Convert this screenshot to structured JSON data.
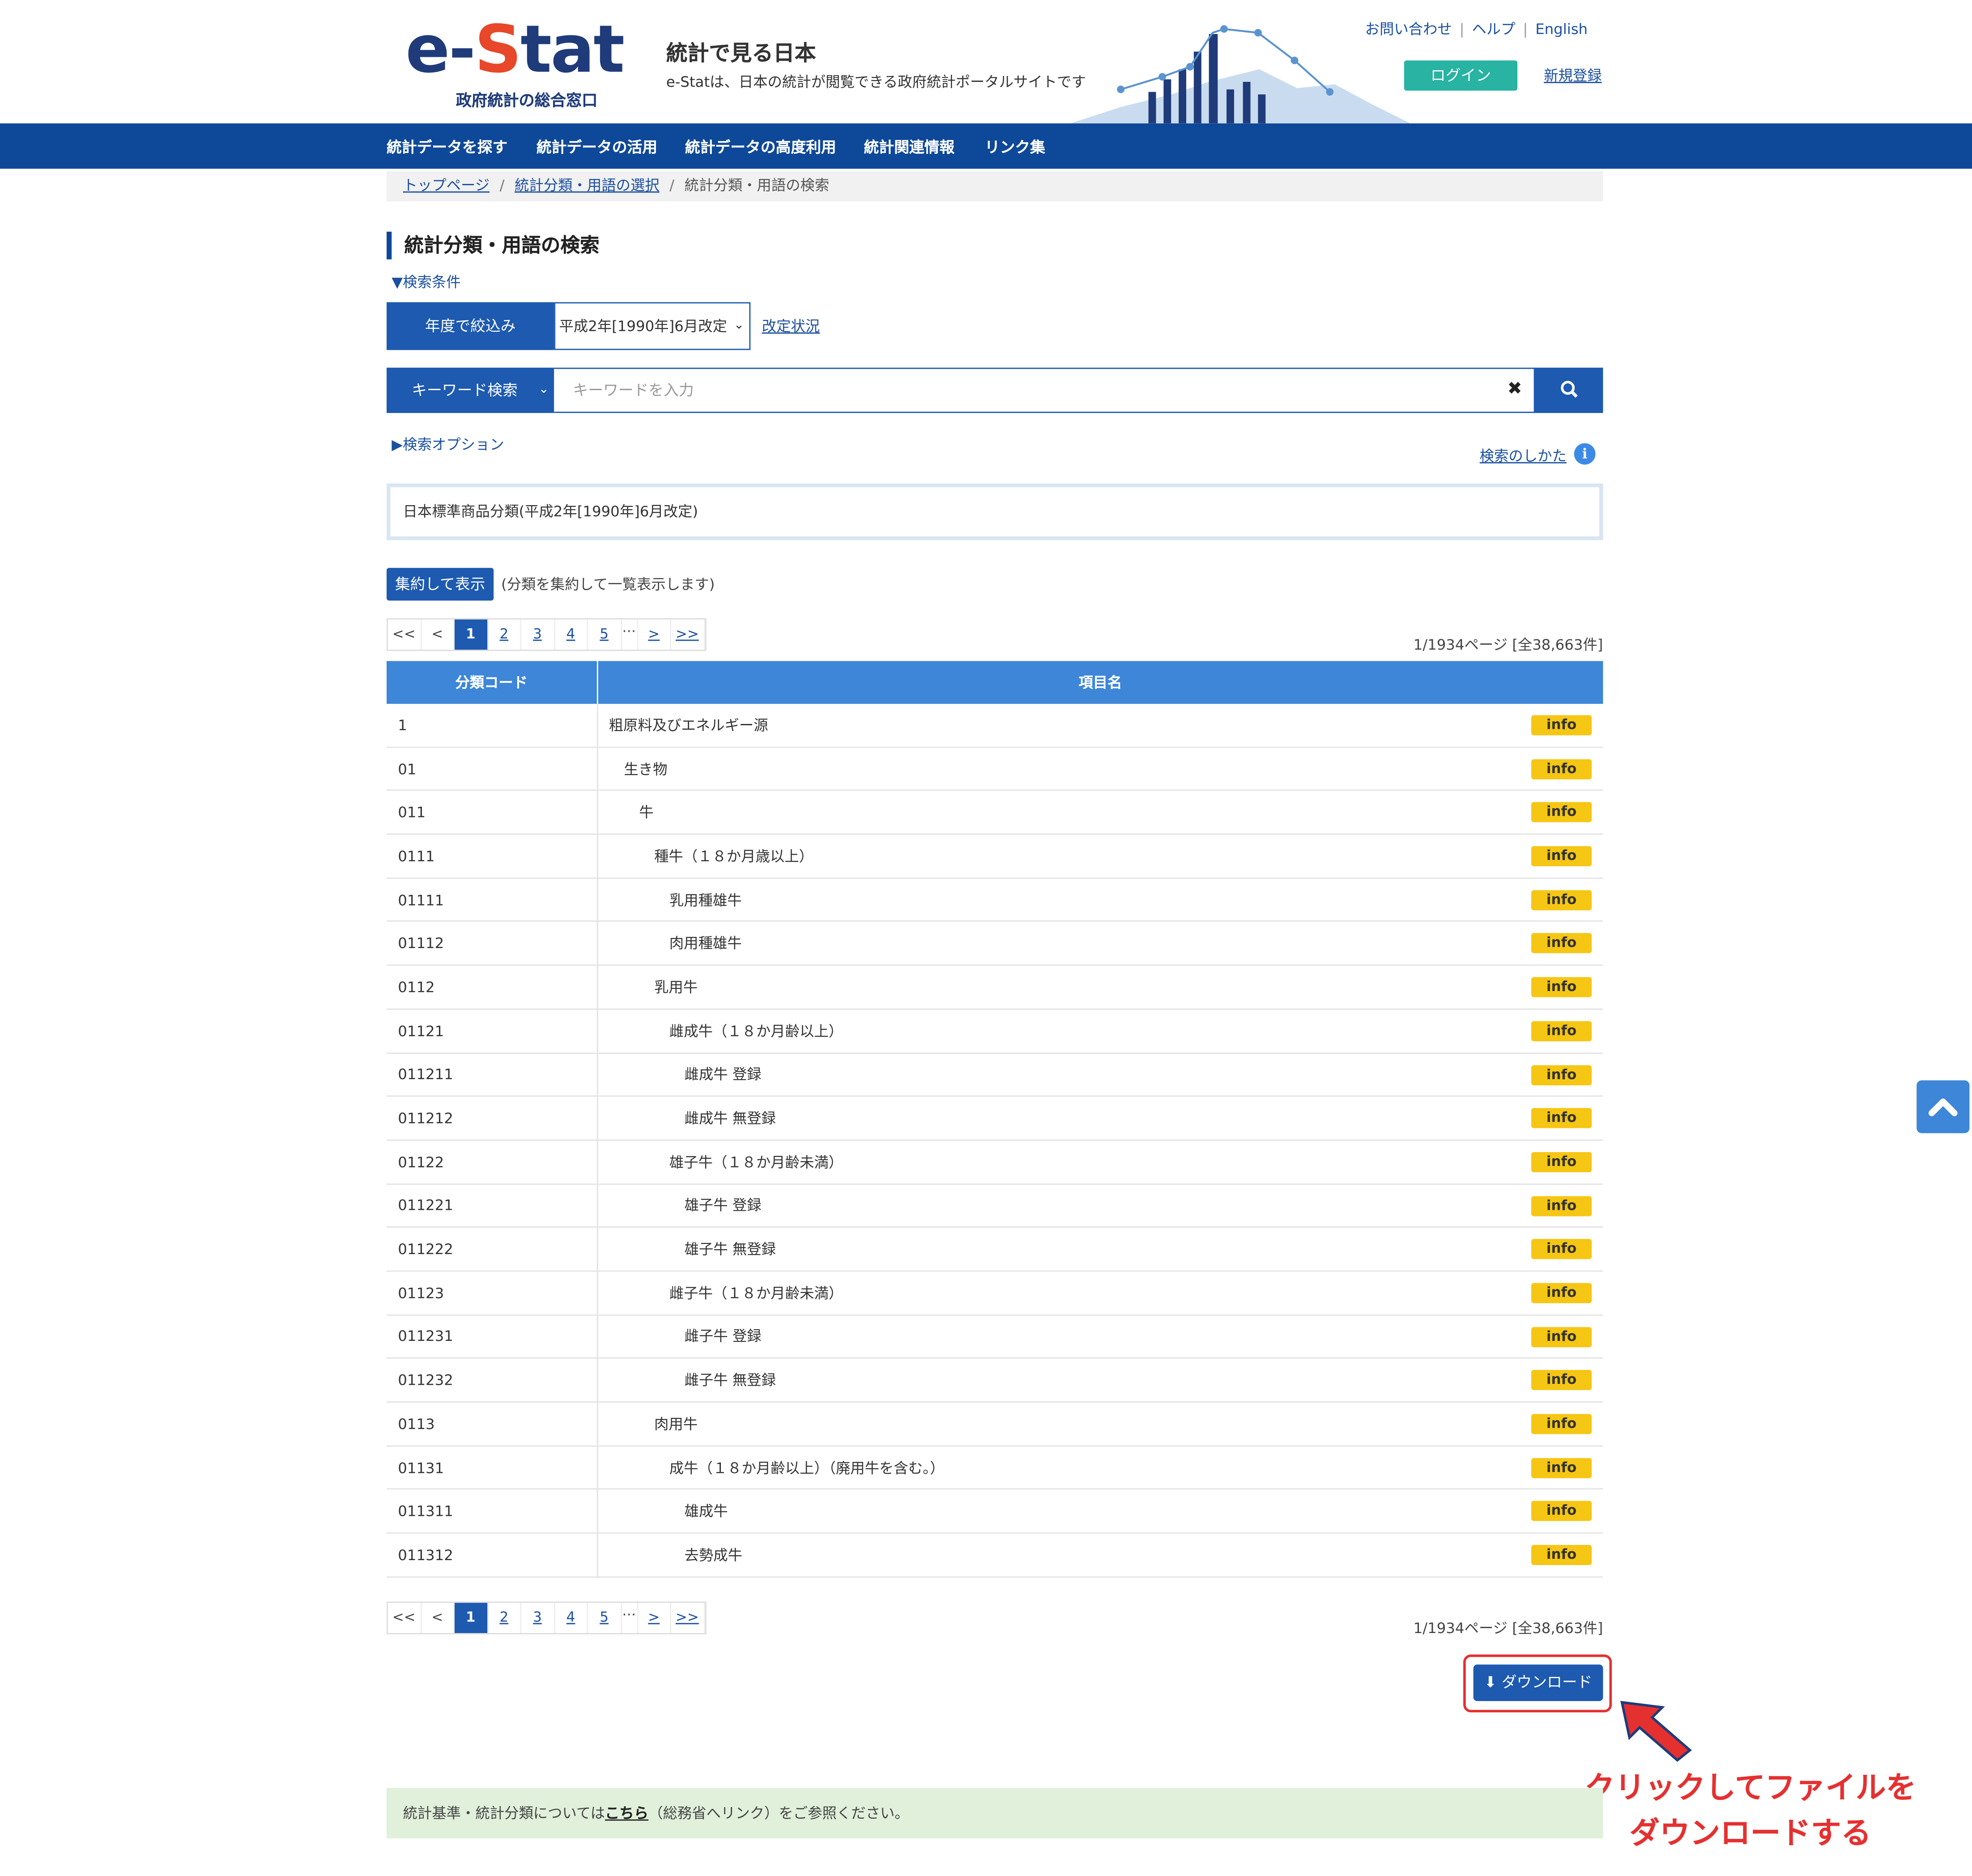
{
  "header": {
    "logo_text": "e-Stat",
    "logo_subtitle": "政府統計の総合窓口",
    "site_title": "統計で見る日本",
    "site_description": "e-Statは、日本の統計が閲覧できる政府統計ポータルサイトです",
    "links": [
      "お問い合わせ",
      "ヘルプ",
      "English"
    ],
    "login_label": "ログイン",
    "register_label": "新規登録"
  },
  "nav": {
    "items": [
      "統計データを探す",
      "統計データの活用",
      "統計データの高度利用",
      "統計関連情報",
      "リンク集"
    ]
  },
  "breadcrumb": [
    "トップページ",
    "統計分類・用語の選択",
    "統計分類・用語の検索"
  ],
  "page_title": "統計分類・用語の検索",
  "search": {
    "conditions_toggle": "検索条件",
    "year_filter_label": "年度で絞込み",
    "year_selected": "平成2年[1990年]6月改定",
    "revision_link": "改定状況",
    "keyword_type": "キーワード検索",
    "keyword_placeholder": "キーワードを入力",
    "options_toggle": "検索オプション",
    "howto_link": "検索のしかた"
  },
  "classification_name": "日本標準商品分類(平成2年[1990年]6月改定)",
  "aggregate": {
    "button": "集約して表示",
    "note": "(分類を集約して一覧表示します)"
  },
  "pagination": {
    "first": "<<",
    "prev": "<",
    "pages": [
      "1",
      "2",
      "3",
      "4",
      "5"
    ],
    "ellipsis": "…",
    "next": ">",
    "last": ">>",
    "summary": "1/1934ページ [全38,663件]"
  },
  "table": {
    "headers": [
      "分類コード",
      "項目名"
    ],
    "info_label": "info",
    "rows": [
      {
        "code": "1",
        "name": "粗原料及びエネルギー源",
        "level": 0
      },
      {
        "code": "01",
        "name": "生き物",
        "level": 1
      },
      {
        "code": "011",
        "name": "牛",
        "level": 2
      },
      {
        "code": "0111",
        "name": "種牛（１８か月歳以上）",
        "level": 3
      },
      {
        "code": "01111",
        "name": "乳用種雄牛",
        "level": 4
      },
      {
        "code": "01112",
        "name": "肉用種雄牛",
        "level": 4
      },
      {
        "code": "0112",
        "name": "乳用牛",
        "level": 3
      },
      {
        "code": "01121",
        "name": "雌成牛（１８か月齢以上）",
        "level": 4
      },
      {
        "code": "011211",
        "name": "雌成牛 登録",
        "level": 5
      },
      {
        "code": "011212",
        "name": "雌成牛 無登録",
        "level": 5
      },
      {
        "code": "01122",
        "name": "雄子牛（１８か月齢未満）",
        "level": 4
      },
      {
        "code": "011221",
        "name": "雄子牛 登録",
        "level": 5
      },
      {
        "code": "011222",
        "name": "雄子牛 無登録",
        "level": 5
      },
      {
        "code": "01123",
        "name": "雌子牛（１８か月齢未満）",
        "level": 4
      },
      {
        "code": "011231",
        "name": "雌子牛 登録",
        "level": 5
      },
      {
        "code": "011232",
        "name": "雌子牛 無登録",
        "level": 5
      },
      {
        "code": "0113",
        "name": "肉用牛",
        "level": 3
      },
      {
        "code": "01131",
        "name": "成牛（１８か月齢以上）（廃用牛を含む。）",
        "level": 4
      },
      {
        "code": "011311",
        "name": "雄成牛",
        "level": 5
      },
      {
        "code": "011312",
        "name": "去勢成牛",
        "level": 5
      }
    ]
  },
  "download_label": "ダウンロード",
  "annotation": {
    "line1": "クリックしてファイルを",
    "line2": "ダウンロードする"
  },
  "footer_note": {
    "prefix": "統計基準・統計分類については",
    "link": "こちら",
    "suffix": "（総務省へリンク）をご参照ください。"
  },
  "colors": {
    "navy": "#0e4898",
    "primary": "#1d5ab0",
    "table_header": "#3d86d8",
    "info_badge": "#f6c614",
    "annotation_red": "#e53030",
    "login_teal": "#28b3a3"
  }
}
